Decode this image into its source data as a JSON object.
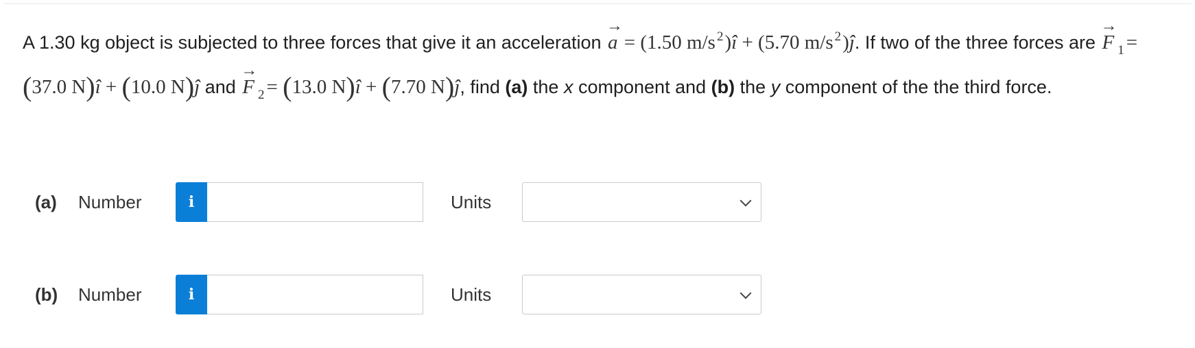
{
  "question": {
    "p1": "A 1.30 kg object is subjected to three forces that give it an acceleration",
    "a_symbol": "a",
    "eq": "=",
    "a_x": "1.50 m/s",
    "a_y": "5.70 m/s",
    "sq": "2",
    "i_hat": "î",
    "j_hat": "ĵ",
    "plus": "+",
    "p2": ". If two of the three forces are",
    "f_symbol": "F",
    "f1_sub": "1",
    "f1_x": "37.0 N",
    "f1_y": "10.0 N",
    "and": "and",
    "f2_sub": "2",
    "f2_x": "13.0 N",
    "f2_y": "7.70 N",
    "p3": ", find",
    "part_a": "(a)",
    "p4": "the",
    "x_var": "x",
    "p5": "component and",
    "part_b": "(b)",
    "p6": "the",
    "y_var": "y",
    "p7": "component of the the third force."
  },
  "answers": [
    {
      "part": "(a)",
      "number_label": "Number",
      "info_icon": "i",
      "number_value": "",
      "units_label": "Units",
      "units_value": ""
    },
    {
      "part": "(b)",
      "number_label": "Number",
      "info_icon": "i",
      "number_value": "",
      "units_label": "Units",
      "units_value": ""
    }
  ],
  "colors": {
    "info_button": "#0b7fd8",
    "border": "#c9c9c9"
  }
}
